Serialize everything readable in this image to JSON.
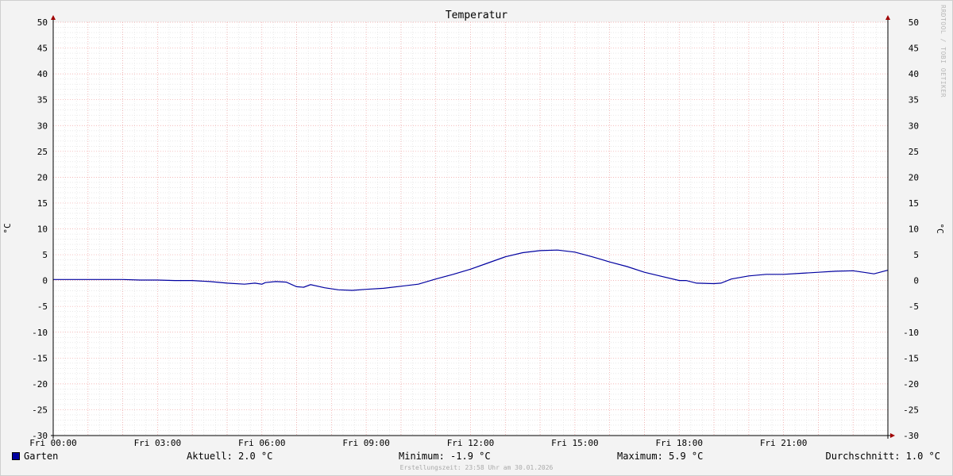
{
  "chart_data": {
    "type": "line",
    "title": "Temperatur",
    "ylabel": "°C",
    "ylabel_right": "°C",
    "ylim": [
      -30,
      50
    ],
    "yticks": [
      50,
      45,
      40,
      35,
      30,
      25,
      20,
      15,
      10,
      5,
      0,
      -5,
      -10,
      -15,
      -20,
      -25,
      -30
    ],
    "xlim": [
      0,
      24
    ],
    "xticks": [
      {
        "hour": 0,
        "label": "Fri 00:00"
      },
      {
        "hour": 3,
        "label": "Fri 03:00"
      },
      {
        "hour": 6,
        "label": "Fri 06:00"
      },
      {
        "hour": 9,
        "label": "Fri 09:00"
      },
      {
        "hour": 12,
        "label": "Fri 12:00"
      },
      {
        "hour": 15,
        "label": "Fri 15:00"
      },
      {
        "hour": 18,
        "label": "Fri 18:00"
      },
      {
        "hour": 21,
        "label": "Fri 21:00"
      }
    ],
    "grid": true,
    "series": [
      {
        "name": "Garten",
        "color": "#0000a0",
        "x": [
          0,
          1,
          2,
          2.5,
          3,
          3.5,
          4,
          4.5,
          5,
          5.5,
          5.8,
          6,
          6.1,
          6.4,
          6.7,
          7,
          7.2,
          7.4,
          7.8,
          8.2,
          8.6,
          9,
          9.5,
          10,
          10.5,
          11,
          11.5,
          12,
          12.5,
          13,
          13.5,
          14,
          14.5,
          15,
          15.5,
          16,
          16.5,
          17,
          17.5,
          18,
          18.2,
          18.5,
          19,
          19.2,
          19.5,
          20,
          20.5,
          21,
          21.5,
          22,
          22.5,
          23,
          23.3,
          23.6,
          24
        ],
        "values": [
          0.2,
          0.2,
          0.2,
          0.1,
          0.1,
          0.0,
          0.0,
          -0.2,
          -0.5,
          -0.7,
          -0.5,
          -0.7,
          -0.4,
          -0.2,
          -0.3,
          -1.2,
          -1.3,
          -0.8,
          -1.4,
          -1.8,
          -1.9,
          -1.7,
          -1.5,
          -1.1,
          -0.7,
          0.3,
          1.2,
          2.2,
          3.4,
          4.6,
          5.4,
          5.8,
          5.9,
          5.5,
          4.6,
          3.6,
          2.7,
          1.6,
          0.8,
          0.0,
          0.0,
          -0.5,
          -0.6,
          -0.5,
          0.3,
          0.9,
          1.2,
          1.2,
          1.4,
          1.6,
          1.8,
          1.9,
          1.6,
          1.3,
          2.0
        ]
      }
    ]
  },
  "watermark": "RRDTOOL / TOBI OETIKER",
  "legend": {
    "series_name": "Garten",
    "swatch_color": "#0000a0"
  },
  "stats": {
    "current": "Aktuell: 2.0 °C",
    "minimum": "Minimum: -1.9 °C",
    "maximum": "Maximum: 5.9 °C",
    "average": "Durchschnitt: 1.0 °C"
  },
  "created": "Erstellungszeit: 23:58 Uhr am 30.01.2026"
}
